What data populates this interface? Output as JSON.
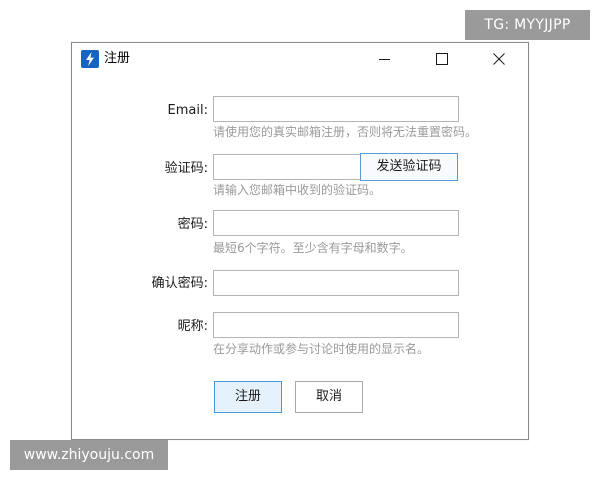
{
  "window": {
    "title": "注册",
    "app_icon": "lightning-icon",
    "controls": {
      "minimize_icon": "minimize-icon",
      "maximize_icon": "maximize-icon",
      "close_icon": "close-icon"
    }
  },
  "form": {
    "email": {
      "label": "Email:",
      "value": "",
      "hint": "请使用您的真实邮箱注册，否则将无法重置密码。"
    },
    "verification_code": {
      "label": "验证码:",
      "value": "",
      "send_button": "发送验证码",
      "hint": "请输入您邮箱中收到的验证码。"
    },
    "password": {
      "label": "密码:",
      "value": "",
      "hint": "最短6个字符。至少含有字母和数字。"
    },
    "confirm_password": {
      "label": "确认密码:",
      "value": ""
    },
    "nickname": {
      "label": "昵称:",
      "value": "",
      "hint": "在分享动作或参与讨论时使用的显示名。"
    }
  },
  "actions": {
    "submit_label": "注册",
    "cancel_label": "取消"
  },
  "watermarks": {
    "top_right": "TG: MYYJJPP",
    "bottom_left": "www.zhiyouju.com"
  },
  "colors": {
    "accent_border": "#4a9ad8",
    "hint_text": "#9a9a9a",
    "app_icon_bg": "#1565c0",
    "watermark_bg": "#9a9a9a"
  }
}
